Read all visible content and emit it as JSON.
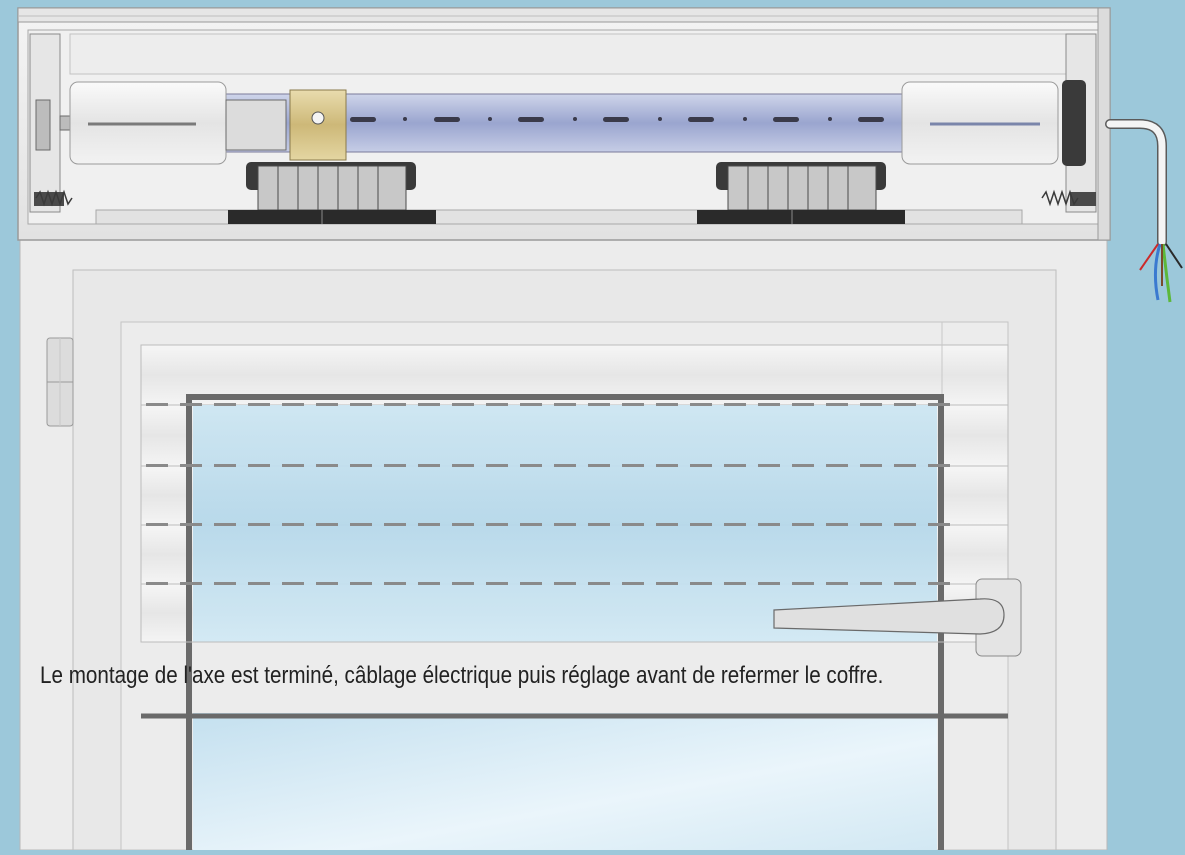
{
  "caption": "Le montage de l'axe est terminé, câblage électrique puis réglage avant de refermer le coffre.",
  "colors": {
    "background": "#9cc8da",
    "frame": "#ececec",
    "glass": "#d8ecf6",
    "tube": "#aab4d6",
    "brass": "#d8c690",
    "wire_blue": "#3a7ad0",
    "wire_green": "#5cb83a",
    "wire_red": "#cc2a2a"
  }
}
